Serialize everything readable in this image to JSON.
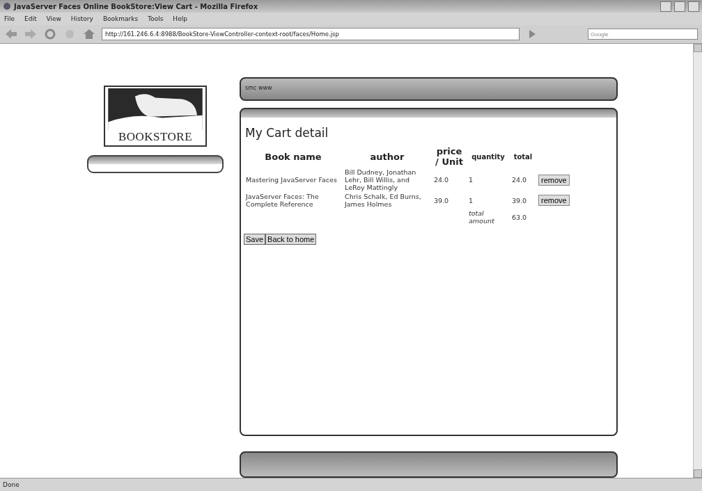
{
  "window": {
    "title": "JavaServer Faces Online BookStore:View Cart - Mozilla Firefox"
  },
  "menu": [
    "File",
    "Edit",
    "View",
    "History",
    "Bookmarks",
    "Tools",
    "Help"
  ],
  "address_bar": {
    "url": "http://161.246.6.4:8988/BookStore-ViewController-context-root/faces/Home.jsp"
  },
  "search": {
    "placeholder": "Google"
  },
  "logo": {
    "text": "BOOKSTORE"
  },
  "header": {
    "text": "smc www"
  },
  "cart": {
    "title": "My Cart detail",
    "columns": [
      "Book name",
      "author",
      "price / Unit",
      "quantity",
      "total"
    ],
    "rows": [
      {
        "book": "Mastering JavaServer Faces",
        "author": "Bill Dudney, Jonathan Lehr, Bill Willis, and LeRoy Mattingly",
        "price": "24.0",
        "quantity": "1",
        "total": "24.0",
        "action": "remove"
      },
      {
        "book": "JavaServer Faces: The Complete Reference",
        "author": "Chris Schalk, Ed Burns, James Holmes",
        "price": "39.0",
        "quantity": "1",
        "total": "39.0",
        "action": "remove"
      }
    ],
    "total_label": "total amount",
    "total_value": "63.0",
    "buttons": [
      "Save",
      "Back to home"
    ]
  },
  "status_bar": {
    "text": "Done"
  }
}
